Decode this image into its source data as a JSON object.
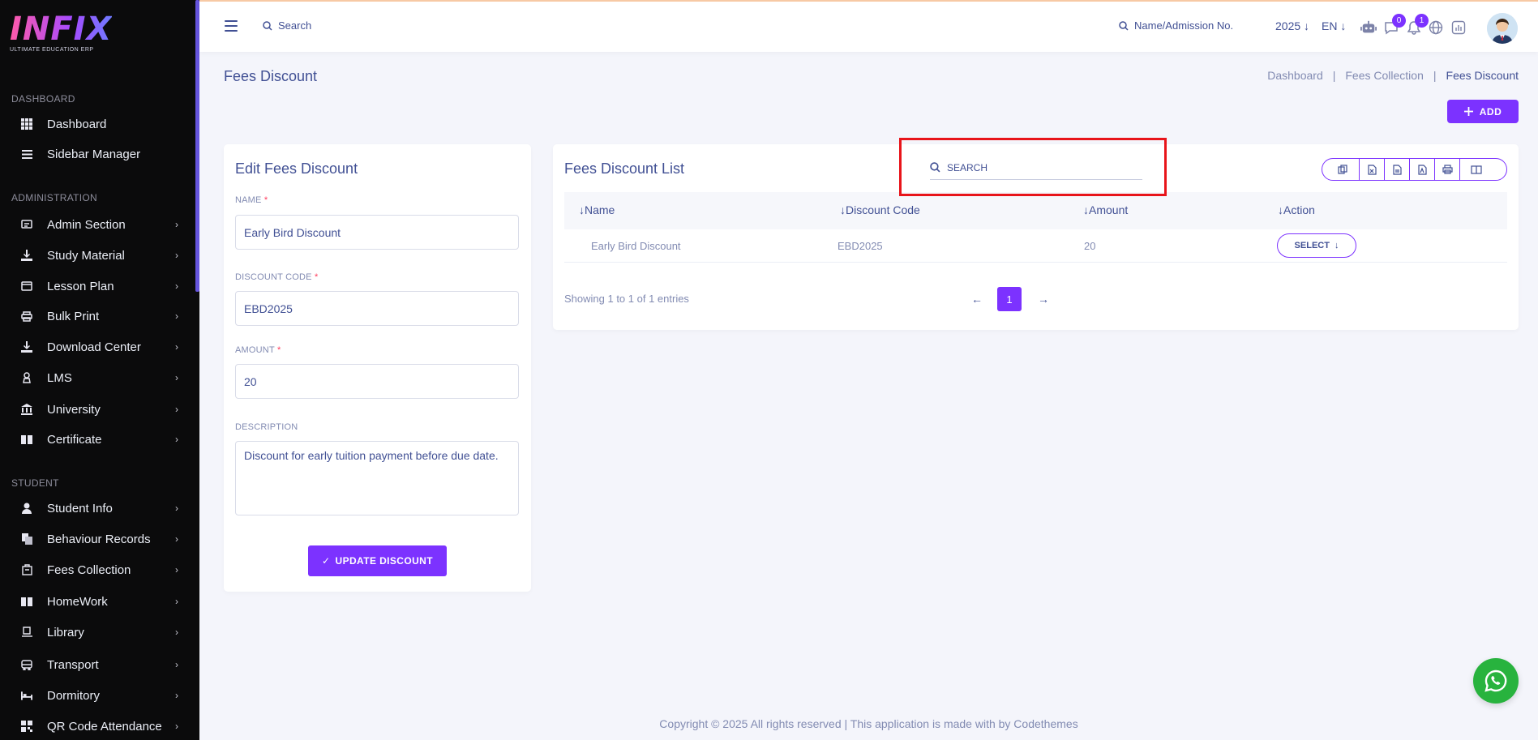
{
  "brand": {
    "logo_text": "INFIX",
    "tagline": "ULTIMATE EDUCATION ERP"
  },
  "sidebar": {
    "sections": [
      {
        "label": "DASHBOARD"
      },
      {
        "label": "ADMINISTRATION"
      },
      {
        "label": "STUDENT"
      }
    ],
    "items": [
      {
        "label": "Dashboard",
        "icon": "grid-icon"
      },
      {
        "label": "Sidebar Manager",
        "icon": "menu-lines-icon"
      },
      {
        "label": "Admin Section",
        "icon": "admin-icon"
      },
      {
        "label": "Study Material",
        "icon": "download-tray-icon"
      },
      {
        "label": "Lesson Plan",
        "icon": "lesson-icon"
      },
      {
        "label": "Bulk Print",
        "icon": "printer-icon"
      },
      {
        "label": "Download Center",
        "icon": "download-tray-icon"
      },
      {
        "label": "LMS",
        "icon": "lms-icon"
      },
      {
        "label": "University",
        "icon": "university-icon"
      },
      {
        "label": "Certificate",
        "icon": "book-icon"
      },
      {
        "label": "Student Info",
        "icon": "user-icon"
      },
      {
        "label": "Behaviour Records",
        "icon": "records-icon"
      },
      {
        "label": "Fees Collection",
        "icon": "fees-icon"
      },
      {
        "label": "HomeWork",
        "icon": "book-icon"
      },
      {
        "label": "Library",
        "icon": "library-icon"
      },
      {
        "label": "Transport",
        "icon": "bus-icon"
      },
      {
        "label": "Dormitory",
        "icon": "bed-icon"
      },
      {
        "label": "QR Code Attendance",
        "icon": "qr-icon"
      }
    ]
  },
  "topbar": {
    "search_placeholder": "Search",
    "admission_placeholder": "Name/Admission No.",
    "year": "2025",
    "language": "EN",
    "chat_badge": "0",
    "notification_badge": "1"
  },
  "page": {
    "title": "Fees Discount",
    "breadcrumb": [
      "Dashboard",
      "Fees Collection",
      "Fees Discount"
    ],
    "add_label": "ADD"
  },
  "edit_form": {
    "title": "Edit Fees Discount",
    "name_label": "NAME",
    "name_value": "Early Bird Discount",
    "code_label": "DISCOUNT CODE",
    "code_value": "EBD2025",
    "amount_label": "AMOUNT",
    "amount_value": "20",
    "description_label": "DESCRIPTION",
    "description_value": "Discount for early tuition payment before due date.",
    "submit_label": "UPDATE DISCOUNT",
    "required_mark": "*"
  },
  "list": {
    "title": "Fees Discount List",
    "search_placeholder": "SEARCH",
    "columns": [
      "Name",
      "Discount Code",
      "Amount",
      "Action"
    ],
    "rows": [
      {
        "name": "Early Bird Discount",
        "code": "EBD2025",
        "amount": "20",
        "action": "SELECT"
      }
    ],
    "showing": "Showing 1 to 1 of 1 entries",
    "current_page": "1"
  },
  "footer": {
    "text": "Copyright © 2025 All rights reserved | This application is made with by Codethemes"
  },
  "colors": {
    "accent": "#7c32ff",
    "sidebar_bg": "#0b0b0c",
    "text": "#415094",
    "highlight": "#e8141a",
    "whatsapp": "#28b33e"
  }
}
